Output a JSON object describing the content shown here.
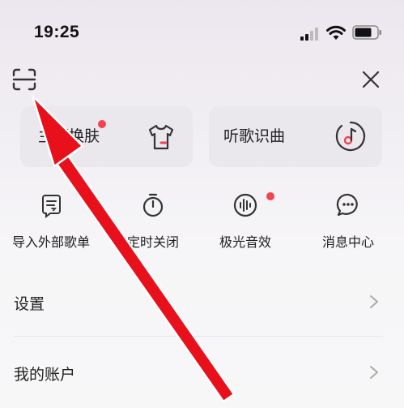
{
  "status_bar": {
    "time": "19:25"
  },
  "quick_cards": [
    {
      "label": "主题换肤",
      "icon": "tshirt-icon",
      "has_dot": true
    },
    {
      "label": "听歌识曲",
      "icon": "music-disc-icon",
      "has_dot": false
    }
  ],
  "features": [
    {
      "label": "导入外部歌单",
      "icon": "import-playlist-icon"
    },
    {
      "label": "定时关闭",
      "icon": "timer-icon"
    },
    {
      "label": "极光音效",
      "icon": "audio-waveform-icon",
      "has_dot": true
    },
    {
      "label": "消息中心",
      "icon": "message-bubble-icon"
    }
  ],
  "menu_rows": [
    {
      "label": "设置"
    },
    {
      "label": "我的账户"
    }
  ],
  "colors": {
    "badge_red": "#f2434f",
    "arrow_red": "#e8101a",
    "card_bg": "#e9e5ec"
  }
}
